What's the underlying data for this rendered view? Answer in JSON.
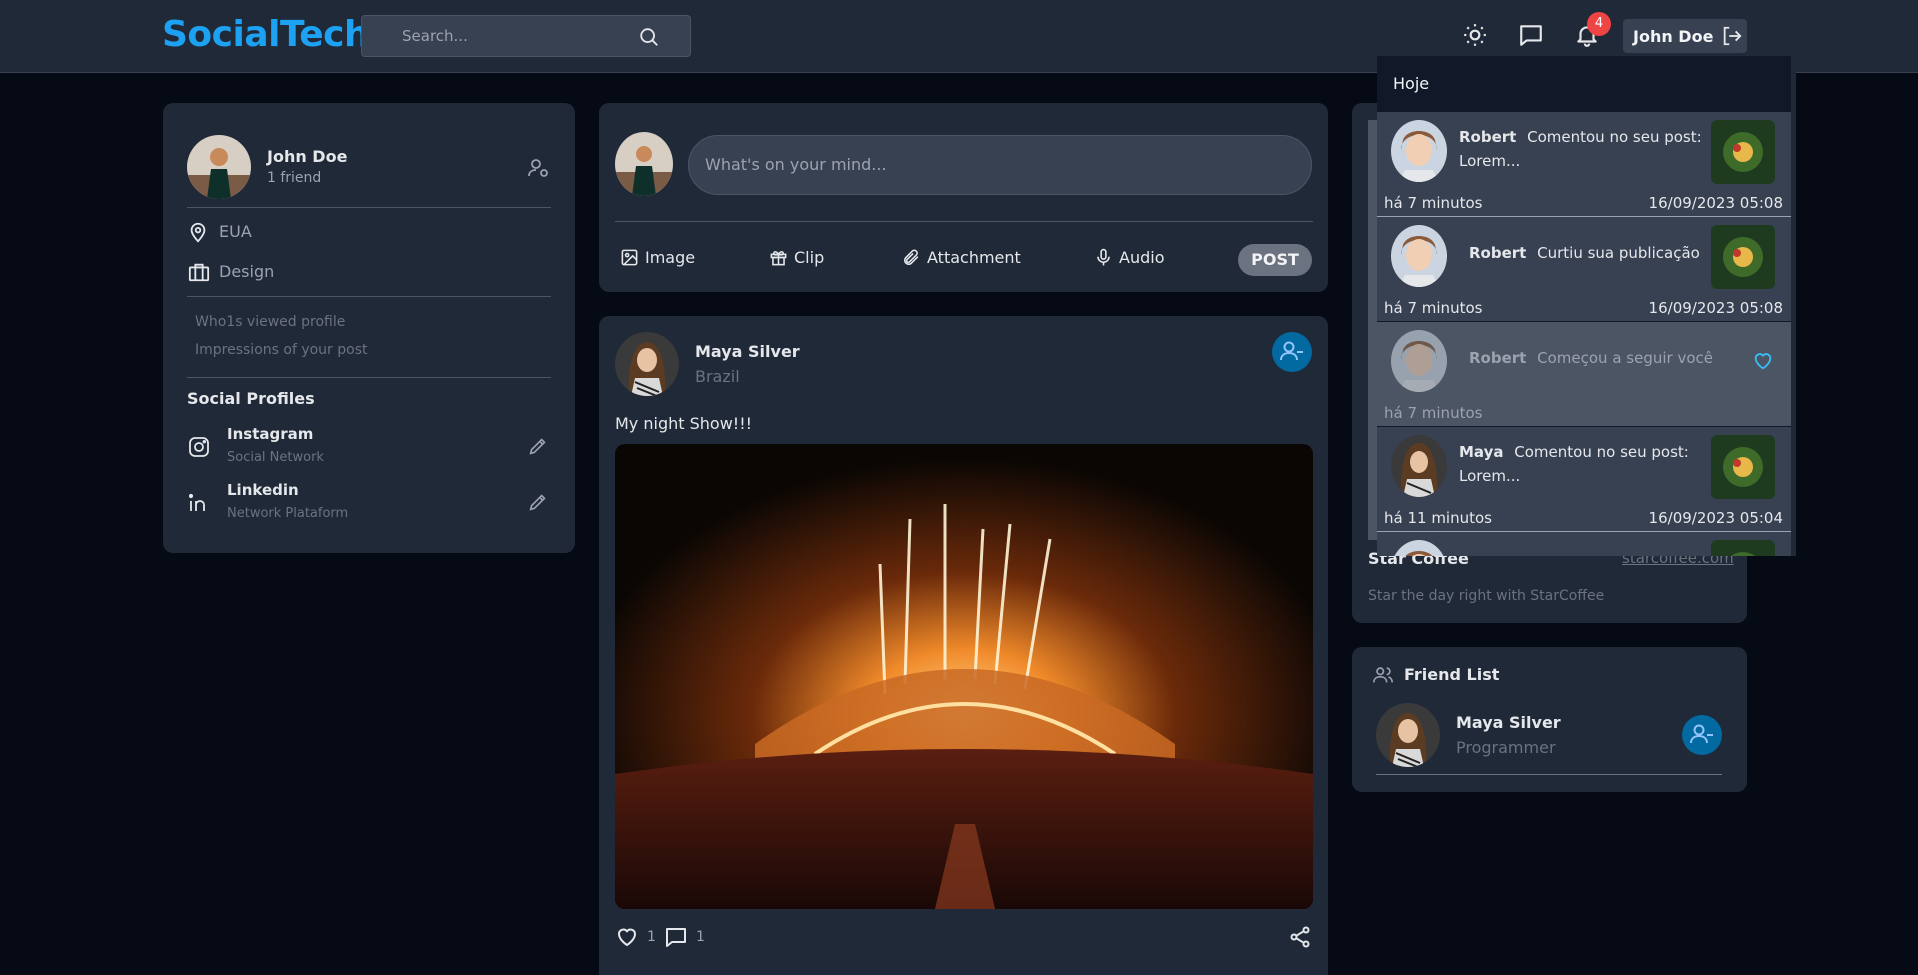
{
  "app": {
    "logo": "SocialTech"
  },
  "header": {
    "search_placeholder": "Search...",
    "notification_count": "4",
    "user_name": "John Doe"
  },
  "profile": {
    "name": "John Doe",
    "friends": "1 friend",
    "location": "EUA",
    "occupation": "Design",
    "viewed_label": "Who1s viewed profile",
    "impressions_label": "Impressions of your post",
    "social_title": "Social Profiles",
    "socials": [
      {
        "name": "Instagram",
        "sub": "Social Network"
      },
      {
        "name": "Linkedin",
        "sub": "Network Plataform"
      }
    ]
  },
  "composer": {
    "placeholder": "What's on your mind...",
    "actions": [
      "Image",
      "Clip",
      "Attachment",
      "Audio"
    ],
    "post_label": "POST"
  },
  "post": {
    "author": "Maya Silver",
    "location": "Brazil",
    "text": "My night Show!!!",
    "likes": "1",
    "comments": "1"
  },
  "ad": {
    "title": "Star Coffee",
    "link": "starcoffee.com",
    "description": "Star the day right with StarCoffee"
  },
  "friends": {
    "title": "Friend List",
    "items": [
      {
        "name": "Maya Silver",
        "role": "Programmer"
      }
    ]
  },
  "notifications": {
    "header": "Hoje",
    "items": [
      {
        "user": "Robert",
        "action": "Comentou no seu post:",
        "action2": "Lorem...",
        "ago": "há 7 minutos",
        "date": "16/09/2023 05:08"
      },
      {
        "user": "Robert",
        "action": "Curtiu sua publicação",
        "action2": "",
        "ago": "há 7 minutos",
        "date": "16/09/2023 05:08"
      },
      {
        "user": "Robert",
        "action": "Começou a seguir você",
        "action2": "",
        "ago": "há 7 minutos",
        "date": ""
      },
      {
        "user": "Maya",
        "action": "Comentou no seu post:",
        "action2": "Lorem...",
        "ago": "há 11 minutos",
        "date": "16/09/2023 05:04"
      }
    ]
  },
  "colors": {
    "accent": "#1da1f2",
    "badge": "#ef4444",
    "button": "#0369a1"
  }
}
